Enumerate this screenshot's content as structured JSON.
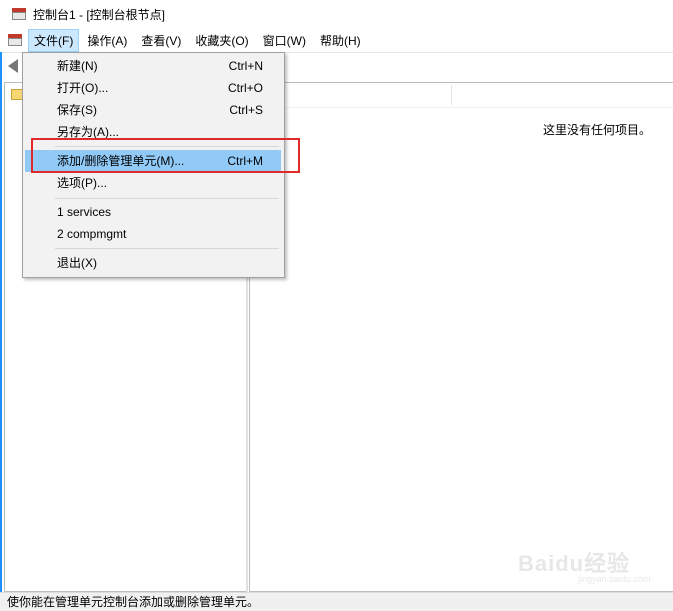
{
  "window": {
    "title": "控制台1 - [控制台根节点]"
  },
  "menubar": {
    "items": [
      {
        "label": "文件(F)"
      },
      {
        "label": "操作(A)"
      },
      {
        "label": "查看(V)"
      },
      {
        "label": "收藏夹(O)"
      },
      {
        "label": "窗口(W)"
      },
      {
        "label": "帮助(H)"
      }
    ]
  },
  "file_menu": {
    "items": [
      {
        "label": "新建(N)",
        "shortcut": "Ctrl+N"
      },
      {
        "label": "打开(O)...",
        "shortcut": "Ctrl+O"
      },
      {
        "label": "保存(S)",
        "shortcut": "Ctrl+S"
      },
      {
        "label": "另存为(A)..."
      },
      {
        "label": "添加/删除管理单元(M)...",
        "shortcut": "Ctrl+M"
      },
      {
        "label": "选项(P)..."
      },
      {
        "label": "1 services"
      },
      {
        "label": "2 compmgmt"
      },
      {
        "label": "退出(X)"
      }
    ]
  },
  "right_pane": {
    "empty_message": "这里没有任何项目。"
  },
  "statusbar": {
    "text": "使你能在管理单元控制台添加或删除管理单元。"
  },
  "watermark": {
    "text": "Baidu经验",
    "sub": "jingyan.baidu.com"
  },
  "colors": {
    "highlight": "#91c9f7",
    "annotation_box": "#e02a2a",
    "active_menu": "#cce8ff"
  }
}
